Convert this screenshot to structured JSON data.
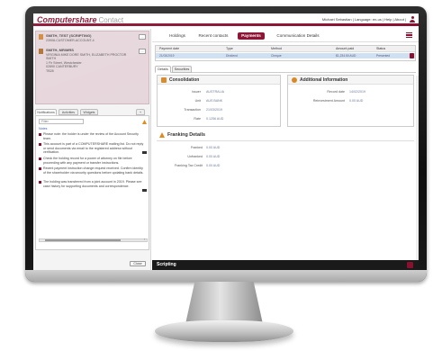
{
  "header": {
    "brand": "Computershare",
    "product": "Contact",
    "user_links": "Michael Sebastian | Language: en-us | Help | About |"
  },
  "caller": {
    "title": "SMITH, TEST (SCRIPTING)",
    "line1": "23908-CUSTOMER-ACCOUNT-4",
    "account_title": "SMITH, MR/MRS",
    "account_line1": "VIRGINIA MIKE DORE SMITH, ELIZABETH PROCTOR",
    "account_line2": "SMITH",
    "account_line3": "1 Fir Street, Westchester",
    "account_line4": "02890 CANTERBURY",
    "account_line5": "TB28",
    "button_label": "..."
  },
  "left_tabs": [
    "Notifications",
    "Activities",
    "Widgets"
  ],
  "left_tab_more": "+",
  "search": {
    "placeholder": "Filter"
  },
  "notes_header_link": "Notes",
  "notes": [
    {
      "text": "Please note: the holder is under the review of the Account Security team.",
      "tagged": false
    },
    {
      "text": "This account is part of a COMPUTERSHARE mailing list. Do not reply or send documents via email to the registered address without verification.",
      "tagged": true
    },
    {
      "text": "Check the holding record for a power of attorney on file before proceeding with any payment or transfer instructions.",
      "tagged": false
    },
    {
      "text": "Recent payment instruction change request received. Confirm identity of the shareholder via security questions before updating bank details.",
      "tagged": false
    },
    {
      "text": "The holding was transferred from a joint account in 2019. Please see case history for supporting documents and correspondence.",
      "tagged": true
    }
  ],
  "left_footer_button": "Close",
  "nav": {
    "tabs": [
      "Holdings",
      "Recent contacts",
      "Payments",
      "Communication Details"
    ],
    "active": "Payments"
  },
  "grid": {
    "headers": [
      "Payment date",
      "Type",
      "Method",
      "Amount paid",
      "Status"
    ],
    "row": [
      "21/03/2019",
      "Dividend",
      "Cheque",
      "$1,234.50 AUD",
      "Presented"
    ]
  },
  "subtabs": [
    "Details",
    "Securities"
  ],
  "consolidation": {
    "title": "Consolidation",
    "rows": [
      {
        "label": "Issuer",
        "value": "AUSTRALIA"
      },
      {
        "label": "Unit",
        "value": "AUS BANK"
      },
      {
        "label": "Transaction",
        "value": "21/03/2019"
      },
      {
        "label": "Rate",
        "value": "0.1256 AUD"
      }
    ]
  },
  "additional": {
    "title": "Additional Information",
    "rows": [
      {
        "label": "Record date",
        "value": "14/02/2019"
      },
      {
        "label": "Reinvestment Amount",
        "value": "0.00 AUD"
      }
    ]
  },
  "franking": {
    "title": "Franking Details",
    "rows": [
      {
        "label": "Franked",
        "value": "0.00 AUD"
      },
      {
        "label": "Unfranked",
        "value": "0.00 AUD"
      },
      {
        "label": "Franking Tax Credit",
        "value": "0.00 AUD"
      }
    ]
  },
  "scripting": {
    "label": "Scripting"
  },
  "colors": {
    "brand": "#8a1030",
    "accent": "#e08a1e",
    "selection": "#cfe0f3"
  }
}
